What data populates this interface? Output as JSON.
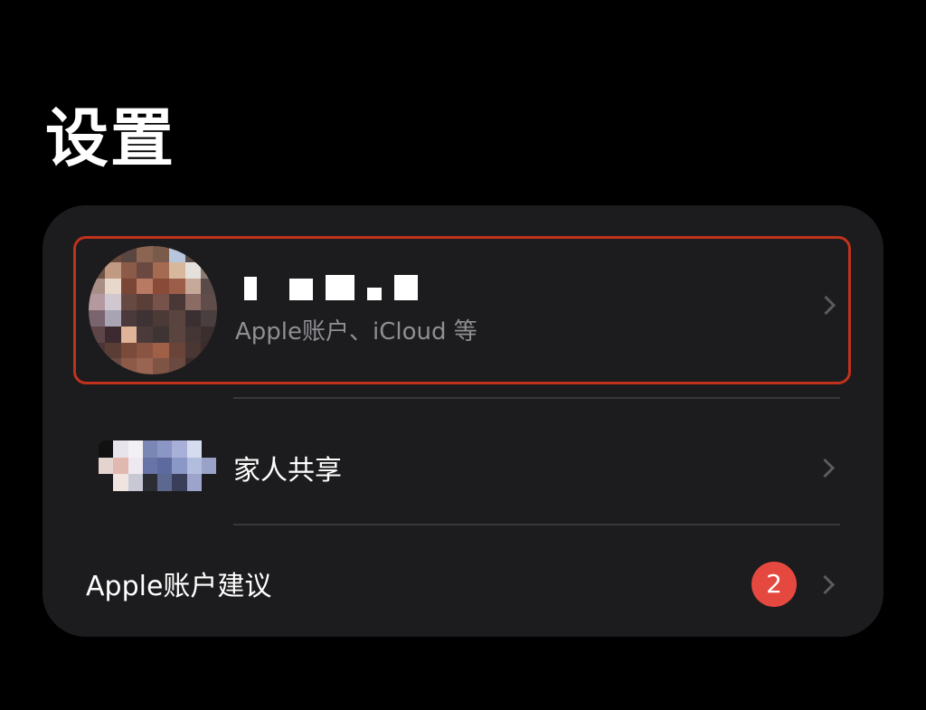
{
  "page": {
    "title": "设置"
  },
  "account": {
    "subtitle": "Apple账户、iCloud 等",
    "avatar_icon": "profile-photo-pixelated",
    "chevron_icon": "chevron-right-icon"
  },
  "family": {
    "label": "家人共享",
    "icon": "family-photos-pixelated",
    "chevron_icon": "chevron-right-icon"
  },
  "suggestions": {
    "label": "Apple账户建议",
    "badge": "2",
    "chevron_icon": "chevron-right-icon"
  },
  "colors": {
    "background": "#000000",
    "group_background": "#1c1c1e",
    "highlight_border": "#c1321c",
    "secondary_text": "#8e8e93",
    "badge": "#e5483f",
    "divider": "#38383a"
  }
}
